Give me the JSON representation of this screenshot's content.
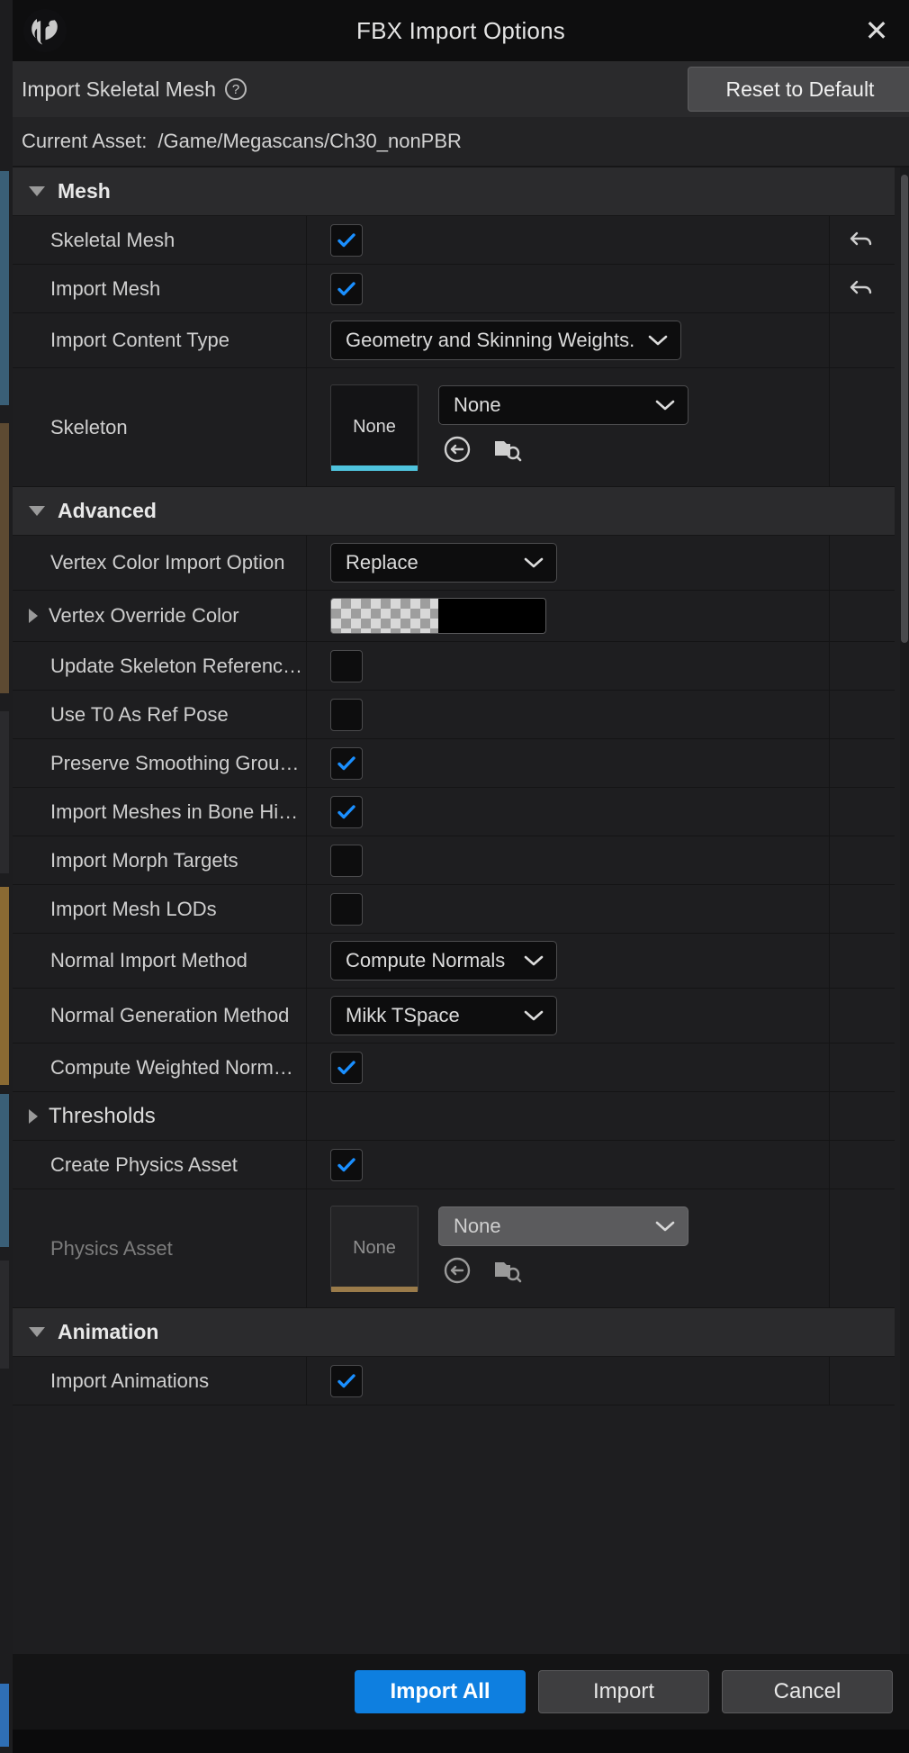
{
  "titlebar": {
    "title": "FBX Import Options",
    "logo_icon": "unreal-engine-logo",
    "close_icon": "close-icon",
    "close_label": "✕"
  },
  "subheader": {
    "label": "Import Skeletal Mesh",
    "help_icon": "help-icon",
    "help_glyph": "?",
    "reset_label": "Reset to Default"
  },
  "asset_bar": {
    "key": "Current Asset:",
    "value": "/Game/Megascans/Ch30_nonPBR"
  },
  "sections": [
    {
      "name": "Mesh",
      "expanded": true,
      "rows": [
        {
          "label": "Skeletal Mesh",
          "type": "checkbox",
          "checked": true,
          "reset": true
        },
        {
          "label": "Import Mesh",
          "type": "checkbox",
          "checked": true,
          "reset": true
        },
        {
          "label": "Import Content Type",
          "type": "dropdown",
          "value": "Geometry and Skinning Weights."
        },
        {
          "label": "Skeleton",
          "type": "asset",
          "thumb": "None",
          "value": "None",
          "icons": [
            "use-selected-asset-icon",
            "browse-content-icon"
          ]
        }
      ]
    },
    {
      "name": "Advanced",
      "expanded": true,
      "rows": [
        {
          "label": "Vertex Color Import Option",
          "type": "dropdown",
          "value": "Replace"
        },
        {
          "label": "Vertex Override Color",
          "type": "color",
          "expandable": true,
          "color": "#000000",
          "alpha": 0
        },
        {
          "label": "Update Skeleton Referenc…",
          "type": "checkbox",
          "checked": false
        },
        {
          "label": "Use T0 As Ref Pose",
          "type": "checkbox",
          "checked": false
        },
        {
          "label": "Preserve Smoothing Grou…",
          "type": "checkbox",
          "checked": true
        },
        {
          "label": "Import Meshes in Bone Hi…",
          "type": "checkbox",
          "checked": true
        },
        {
          "label": "Import Morph Targets",
          "type": "checkbox",
          "checked": false
        },
        {
          "label": "Import Mesh LODs",
          "type": "checkbox",
          "checked": false
        },
        {
          "label": "Normal Import Method",
          "type": "dropdown",
          "value": "Compute Normals"
        },
        {
          "label": "Normal Generation Method",
          "type": "dropdown",
          "value": "Mikk TSpace"
        },
        {
          "label": "Compute Weighted Norm…",
          "type": "checkbox",
          "checked": true
        }
      ]
    },
    {
      "name": "Thresholds",
      "expanded": false,
      "is_subheader": true,
      "rows": []
    }
  ],
  "after_thresholds": [
    {
      "label": "Create Physics Asset",
      "type": "checkbox",
      "checked": true
    },
    {
      "label": "Physics Asset",
      "type": "asset",
      "thumb": "None",
      "value": "None",
      "disabled": true,
      "icons": [
        "use-selected-asset-icon",
        "browse-content-icon"
      ]
    }
  ],
  "animation_section": {
    "name": "Animation",
    "expanded": true,
    "rows": [
      {
        "label": "Import Animations",
        "type": "checkbox",
        "checked": true
      }
    ]
  },
  "footer": {
    "import_all": "Import All",
    "import": "Import",
    "cancel": "Cancel"
  },
  "colors": {
    "accent_blue": "#0e7fe0",
    "check_blue": "#1a8fff",
    "thumb_underline": "#4fc3dd",
    "thumb_underline_disabled": "#9a7b4a",
    "panel_bg": "#1e1e20",
    "header_bg": "#2b2b2d"
  },
  "scrollbar": {
    "name": "vertical-scrollbar"
  }
}
